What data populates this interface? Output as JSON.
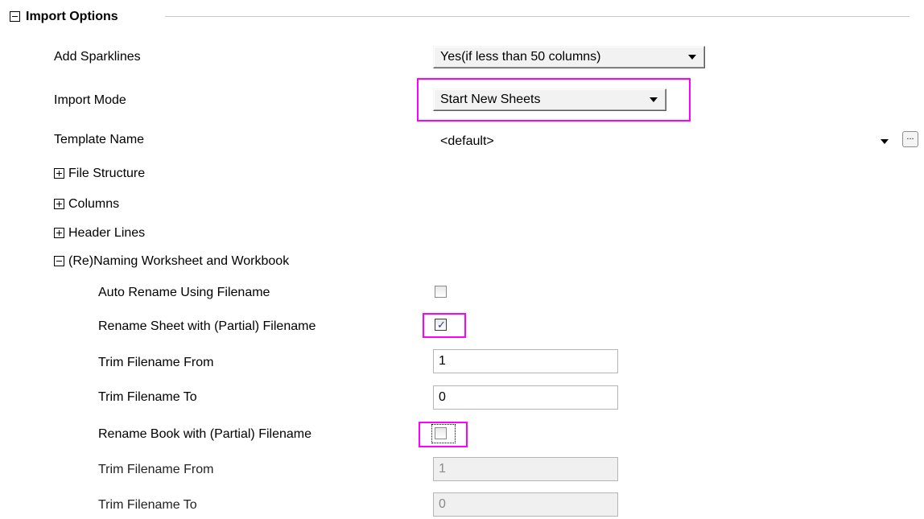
{
  "section": {
    "title": "Import Options"
  },
  "rows": {
    "add_sparklines": {
      "label": "Add Sparklines",
      "value": "Yes(if less than 50 columns)"
    },
    "import_mode": {
      "label": "Import Mode",
      "value": "Start New Sheets"
    },
    "template_name": {
      "label": "Template Name",
      "value": "<default>",
      "browse_label": "..."
    }
  },
  "groups": {
    "file_structure": "File Structure",
    "columns": "Columns",
    "header_lines": "Header Lines",
    "renaming": "(Re)Naming Worksheet and Workbook"
  },
  "renaming": {
    "auto_rename": {
      "label": "Auto Rename Using Filename",
      "checked": false
    },
    "rename_sheet": {
      "label": "Rename Sheet with (Partial) Filename",
      "checked": true
    },
    "sheet_trim_from": {
      "label": "Trim Filename From",
      "value": "1"
    },
    "sheet_trim_to": {
      "label": "Trim Filename To",
      "value": "0"
    },
    "rename_book": {
      "label": "Rename Book with (Partial) Filename",
      "checked": false
    },
    "book_trim_from": {
      "label": "Trim Filename From",
      "value": "1"
    },
    "book_trim_to": {
      "label": "Trim Filename To",
      "value": "0"
    }
  },
  "colors": {
    "highlight": "#ff00ff",
    "check_mark": "#2c3a8c"
  },
  "icons": {
    "collapse": "minus-box-icon",
    "expand": "plus-box-icon",
    "dropdown": "chevron-down-icon"
  }
}
